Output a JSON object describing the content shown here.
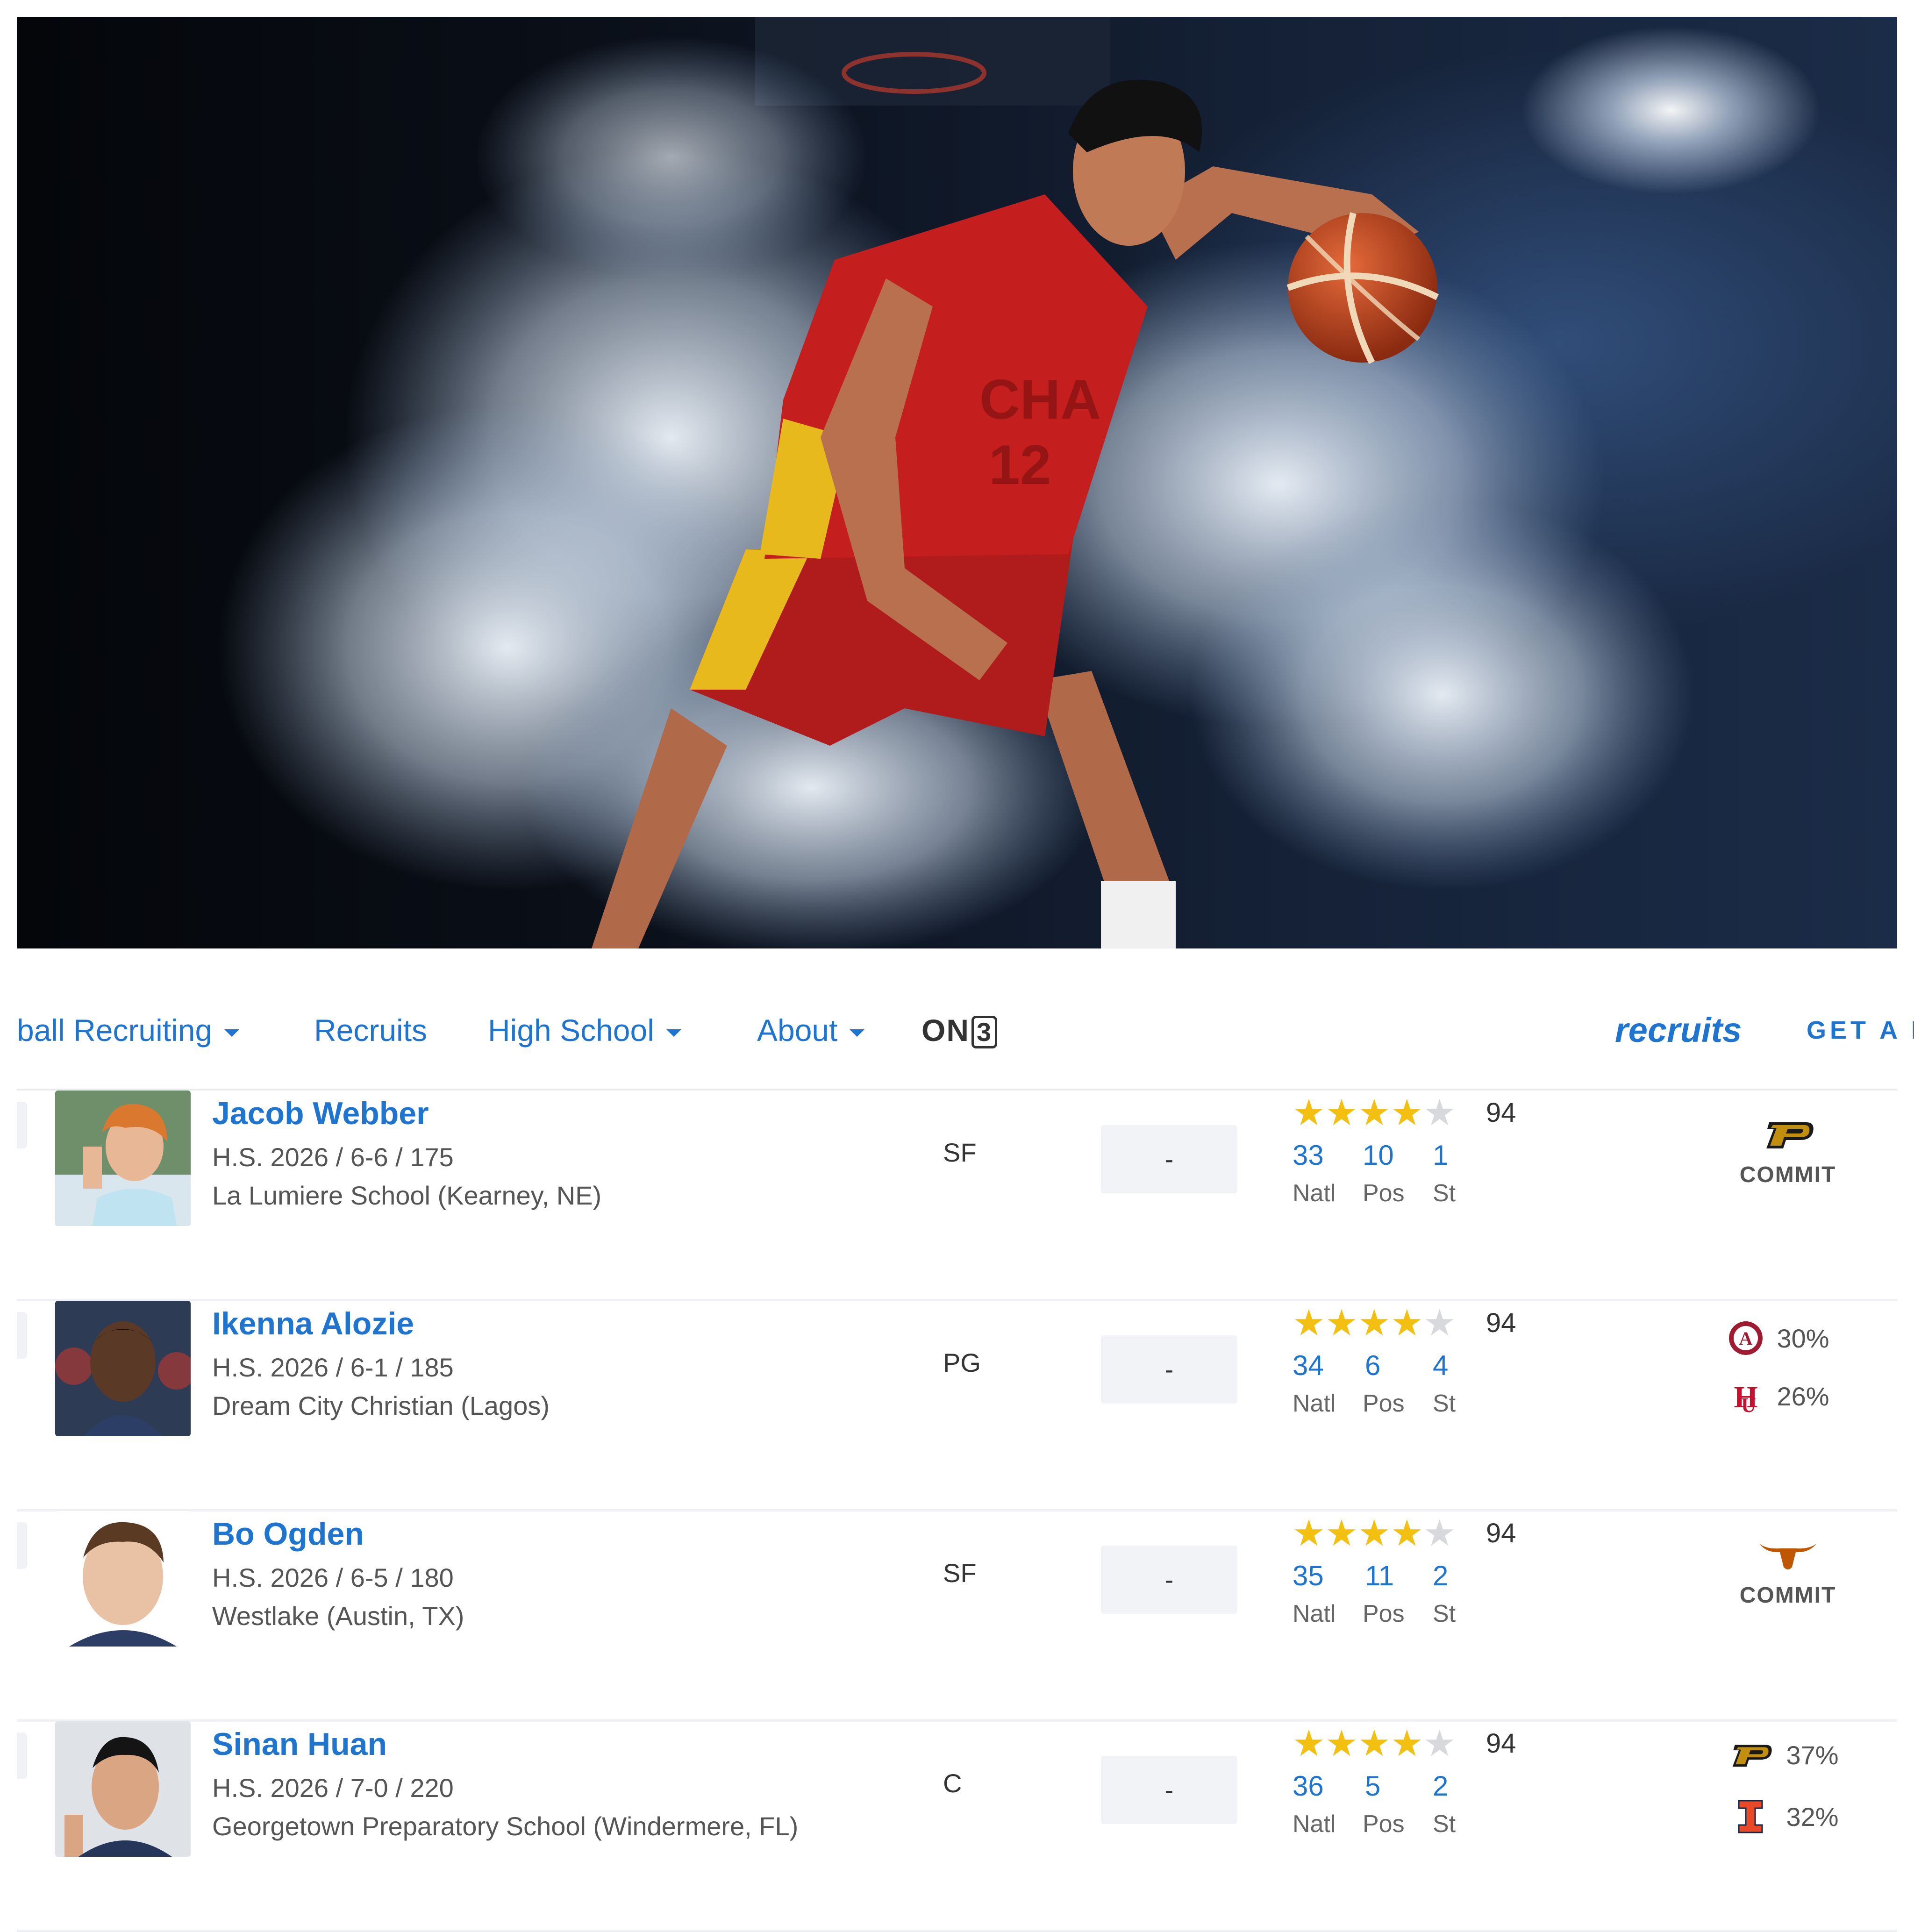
{
  "hero": {
    "jersey_text": "CHA",
    "jersey_number": "12"
  },
  "nav": {
    "items": [
      {
        "label": "ball Recruiting",
        "has_caret": true
      },
      {
        "label": "Recruits",
        "has_caret": false
      },
      {
        "label": "High School",
        "has_caret": true
      },
      {
        "label": "About",
        "has_caret": true
      }
    ],
    "on3_prefix": "ON",
    "on3_suffix": "3",
    "brand": "recruits",
    "cta": "GET A F"
  },
  "recruits": [
    {
      "name": "Jacob Webber",
      "meta": "H.S. 2026 / 6-6 / 175",
      "school": "La Lumiere School (Kearney, NE)",
      "position": "SF",
      "nil": "-",
      "rating": "94",
      "stars": 4,
      "natl": "33",
      "pos_rank": "10",
      "st": "1",
      "labels": {
        "natl": "Natl",
        "pos": "Pos",
        "st": "St"
      },
      "status": "COMMIT",
      "school_logo": "purdue-logo"
    },
    {
      "name": "Ikenna Alozie",
      "meta": "H.S. 2026 / 6-1 / 185",
      "school": "Dream City Christian (Lagos)",
      "position": "PG",
      "nil": "-",
      "rating": "94",
      "stars": 4,
      "natl": "34",
      "pos_rank": "6",
      "st": "4",
      "labels": {
        "natl": "Natl",
        "pos": "Pos",
        "st": "St"
      },
      "predictions": [
        {
          "logo": "alabama-logo",
          "pct": "30%"
        },
        {
          "logo": "houston-logo",
          "pct": "26%"
        }
      ]
    },
    {
      "name": "Bo Ogden",
      "meta": "H.S. 2026 / 6-5 / 180",
      "school": "Westlake (Austin, TX)",
      "position": "SF",
      "nil": "-",
      "rating": "94",
      "stars": 4,
      "natl": "35",
      "pos_rank": "11",
      "st": "2",
      "labels": {
        "natl": "Natl",
        "pos": "Pos",
        "st": "St"
      },
      "status": "COMMIT",
      "school_logo": "texas-longhorn-logo"
    },
    {
      "name": "Sinan Huan",
      "meta": "H.S. 2026 / 7-0 / 220",
      "school": "Georgetown Preparatory School (Windermere, FL)",
      "position": "C",
      "nil": "-",
      "rating": "94",
      "stars": 4,
      "natl": "36",
      "pos_rank": "5",
      "st": "2",
      "labels": {
        "natl": "Natl",
        "pos": "Pos",
        "st": "St"
      },
      "predictions": [
        {
          "logo": "purdue-logo",
          "pct": "37%"
        },
        {
          "logo": "illinois-logo",
          "pct": "32%"
        }
      ]
    }
  ],
  "colors": {
    "link_blue": "#1f74d0",
    "star_gold": "#f3c012",
    "star_off": "#d8d9dc",
    "purdue_gold": "#c28e0e",
    "alabama_red": "#9e1b32",
    "houston_red": "#c8102e",
    "texas_orange": "#bf5700",
    "illinois_orange": "#e84a27"
  }
}
